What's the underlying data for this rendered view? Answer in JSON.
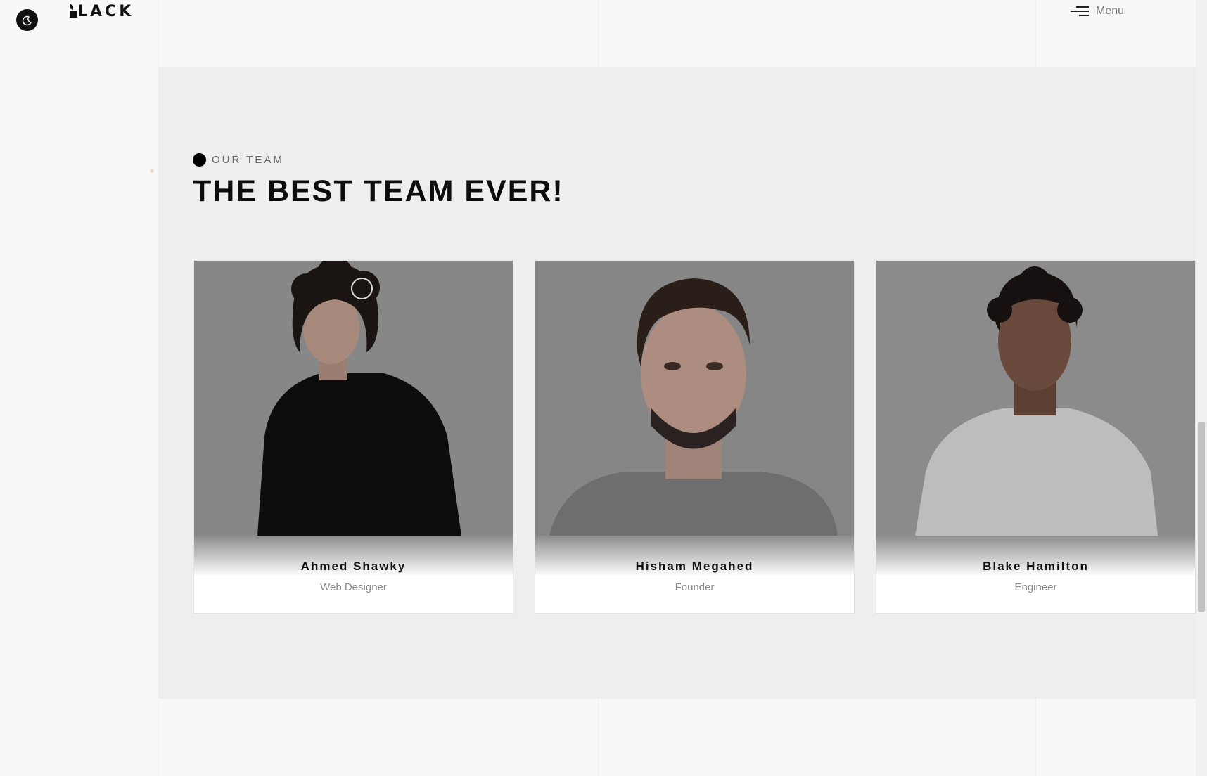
{
  "header": {
    "logo_text": "LACK",
    "menu_label": "Menu"
  },
  "team": {
    "subtitle": "OUR TEAM",
    "heading": "THE BEST TEAM EVER!",
    "members": [
      {
        "name": "Ahmed Shawky",
        "role": "Web Designer"
      },
      {
        "name": "Hisham Megahed",
        "role": "Founder"
      },
      {
        "name": "Blake Hamilton",
        "role": "Engineer"
      }
    ]
  },
  "colors": {
    "accent": "#000000",
    "section_bg": "#eeeeee",
    "page_bg": "#f8f8f8"
  }
}
